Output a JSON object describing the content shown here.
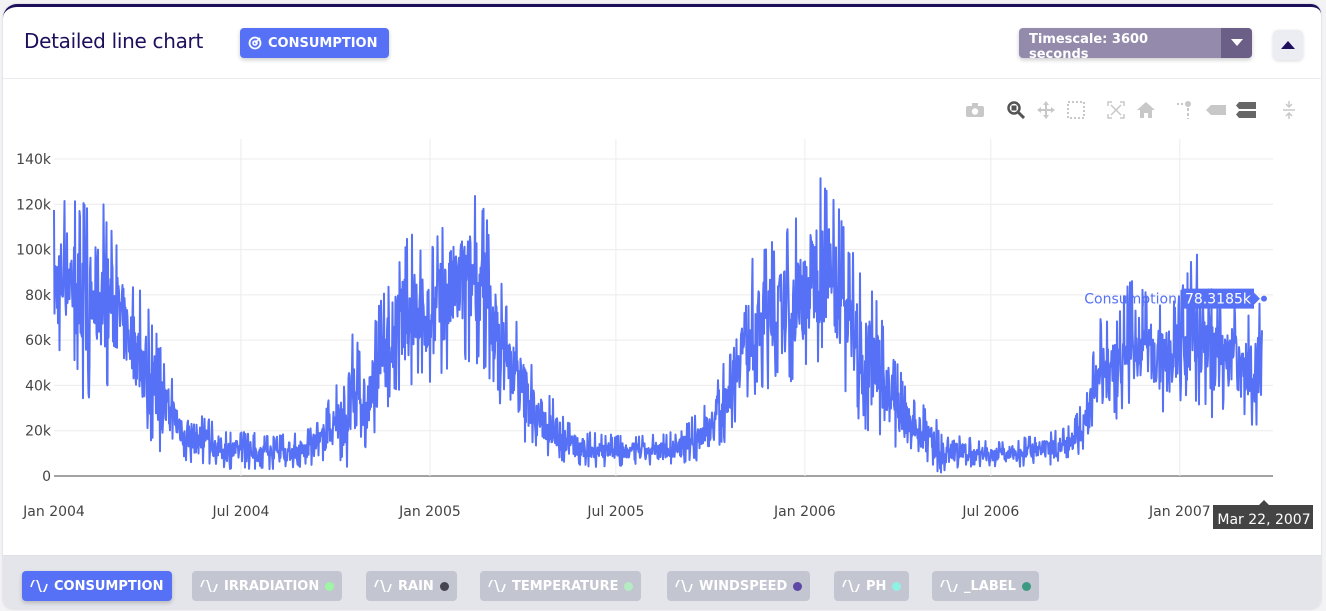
{
  "header": {
    "title": "Detailed line chart",
    "badge": "CONSUMPTION",
    "timescale": "Timescale: 3600 seconds"
  },
  "modebar": [
    "camera-icon",
    "zoom-icon",
    "pan-icon",
    "box-select-icon",
    "autoscale-icon",
    "home-icon",
    "spike-lines-icon",
    "hover-closest-icon",
    "hover-compare-icon",
    "compare-vertical-icon"
  ],
  "legend": [
    {
      "label": "CONSUMPTION",
      "active": true,
      "color": "#5671f5"
    },
    {
      "label": "IRRADIATION",
      "active": false,
      "color": "#9ef5a3"
    },
    {
      "label": "RAIN",
      "active": false,
      "color": "#45444f"
    },
    {
      "label": "TEMPERATURE",
      "active": false,
      "color": "#b5ecc3"
    },
    {
      "label": "WINDSPEED",
      "active": false,
      "color": "#5e47a5"
    },
    {
      "label": "PH",
      "active": false,
      "color": "#8ff0e4"
    },
    {
      "label": "_LABEL",
      "active": false,
      "color": "#3d9a82"
    }
  ],
  "chart_data": {
    "type": "line",
    "series": [
      {
        "name": "Consumption",
        "color": "#5671f5"
      }
    ],
    "x_ticks": [
      "Jan 2004",
      "Jul 2004",
      "Jan 2005",
      "Jul 2005",
      "Jan 2006",
      "Jul 2006",
      "Jan 2007"
    ],
    "y_ticks": [
      "0",
      "20k",
      "40k",
      "60k",
      "80k",
      "100k",
      "120k",
      "140k"
    ],
    "ylim": [
      0,
      140000
    ],
    "xlim": [
      "2004-01-01",
      "2007-03-22"
    ],
    "grid": true,
    "envelope": {
      "x": [
        "2004-01-01",
        "2004-01-15",
        "2004-02-01",
        "2004-02-15",
        "2004-03-01",
        "2004-03-15",
        "2004-04-01",
        "2004-04-15",
        "2004-05-01",
        "2004-05-15",
        "2004-06-01",
        "2004-06-15",
        "2004-07-01",
        "2004-08-01",
        "2004-09-01",
        "2004-09-15",
        "2004-10-01",
        "2004-10-15",
        "2004-11-01",
        "2004-11-15",
        "2004-12-01",
        "2004-12-15",
        "2005-01-01",
        "2005-01-15",
        "2005-02-01",
        "2005-02-15",
        "2005-03-01",
        "2005-03-15",
        "2005-04-01",
        "2005-04-15",
        "2005-05-01",
        "2005-05-15",
        "2005-06-01",
        "2005-07-01",
        "2005-08-01",
        "2005-09-01",
        "2005-10-01",
        "2005-10-15",
        "2005-11-01",
        "2005-11-15",
        "2005-12-01",
        "2005-12-15",
        "2006-01-01",
        "2006-01-15",
        "2006-02-01",
        "2006-02-15",
        "2006-03-01",
        "2006-03-15",
        "2006-04-01",
        "2006-04-15",
        "2006-05-01",
        "2006-05-15",
        "2006-06-01",
        "2006-07-01",
        "2006-08-01",
        "2006-09-01",
        "2006-09-15",
        "2006-10-01",
        "2006-10-15",
        "2006-11-01",
        "2006-11-15",
        "2006-12-01",
        "2006-12-15",
        "2007-01-01",
        "2007-01-15",
        "2007-02-01",
        "2007-02-15",
        "2007-03-01",
        "2007-03-22"
      ],
      "y_min": [
        50000,
        55000,
        25000,
        40000,
        40000,
        35000,
        15000,
        10000,
        8000,
        5000,
        5000,
        3000,
        3000,
        3000,
        4000,
        5000,
        8000,
        0,
        10000,
        25000,
        35000,
        40000,
        40000,
        45000,
        50000,
        50000,
        40000,
        25000,
        15000,
        10000,
        8000,
        5000,
        4000,
        4000,
        4000,
        5000,
        8000,
        15000,
        30000,
        35000,
        40000,
        40000,
        45000,
        50000,
        45000,
        30000,
        20000,
        15000,
        10000,
        5000,
        5000,
        0,
        4000,
        4000,
        4000,
        5000,
        8000,
        10000,
        20000,
        25000,
        30000,
        35000,
        25000,
        30000,
        30000,
        25000,
        30000,
        25000,
        20000
      ],
      "y_max": [
        118000,
        130000,
        120000,
        125000,
        110000,
        90000,
        80000,
        55000,
        40000,
        30000,
        25000,
        20000,
        20000,
        18000,
        20000,
        25000,
        40000,
        65000,
        55000,
        80000,
        100000,
        110000,
        100000,
        115000,
        125000,
        128000,
        110000,
        80000,
        65000,
        45000,
        35000,
        25000,
        20000,
        18000,
        18000,
        20000,
        35000,
        55000,
        90000,
        100000,
        105000,
        110000,
        120000,
        140000,
        125000,
        100000,
        90000,
        75000,
        50000,
        35000,
        30000,
        25000,
        18000,
        15000,
        17000,
        20000,
        22000,
        35000,
        70000,
        70000,
        90000,
        80000,
        75000,
        80000,
        105000,
        85000,
        85000,
        70000,
        80000
      ]
    },
    "hover": {
      "series": "Consumption",
      "value": "78.3185k",
      "date": "Mar 22, 2007"
    }
  }
}
